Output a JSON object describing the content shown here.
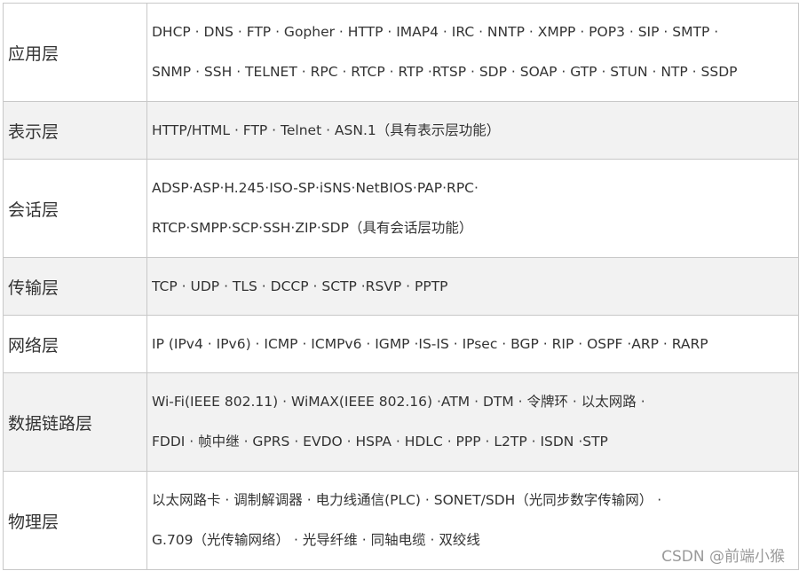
{
  "table": {
    "rows": [
      {
        "layer": "应用层",
        "lines": [
          "DHCP · DNS · FTP · Gopher · HTTP · IMAP4 · IRC · NNTP · XMPP · POP3 · SIP · SMTP ·",
          "SNMP · SSH · TELNET · RPC · RTCP · RTP ·RTSP · SDP · SOAP · GTP · STUN · NTP · SSDP"
        ]
      },
      {
        "layer": "表示层",
        "lines": [
          "HTTP/HTML · FTP · Telnet · ASN.1（具有表示层功能）"
        ]
      },
      {
        "layer": "会话层",
        "lines": [
          "ADSP·ASP·H.245·ISO-SP·iSNS·NetBIOS·PAP·RPC·",
          "RTCP·SMPP·SCP·SSH·ZIP·SDP（具有会话层功能）"
        ]
      },
      {
        "layer": "传输层",
        "lines": [
          "TCP · UDP · TLS · DCCP · SCTP ·RSVP · PPTP"
        ]
      },
      {
        "layer": "网络层",
        "lines": [
          "IP (IPv4 · IPv6) · ICMP · ICMPv6 · IGMP ·IS-IS · IPsec · BGP · RIP · OSPF ·ARP · RARP"
        ]
      },
      {
        "layer": "数据链路层",
        "lines": [
          "Wi-Fi(IEEE 802.11) · WiMAX(IEEE 802.16) ·ATM · DTM · 令牌环 · 以太网路 ·",
          "FDDI · 帧中继 · GPRS · EVDO · HSPA · HDLC · PPP · L2TP · ISDN ·STP"
        ]
      },
      {
        "layer": "物理层",
        "lines": [
          "以太网路卡 · 调制解调器 · 电力线通信(PLC) · SONET/SDH（光同步数字传输网） ·",
          "G.709（光传输网络） · 光导纤维 · 同轴电缆 · 双绞线"
        ]
      }
    ]
  },
  "watermark": "CSDN @前端小猴"
}
